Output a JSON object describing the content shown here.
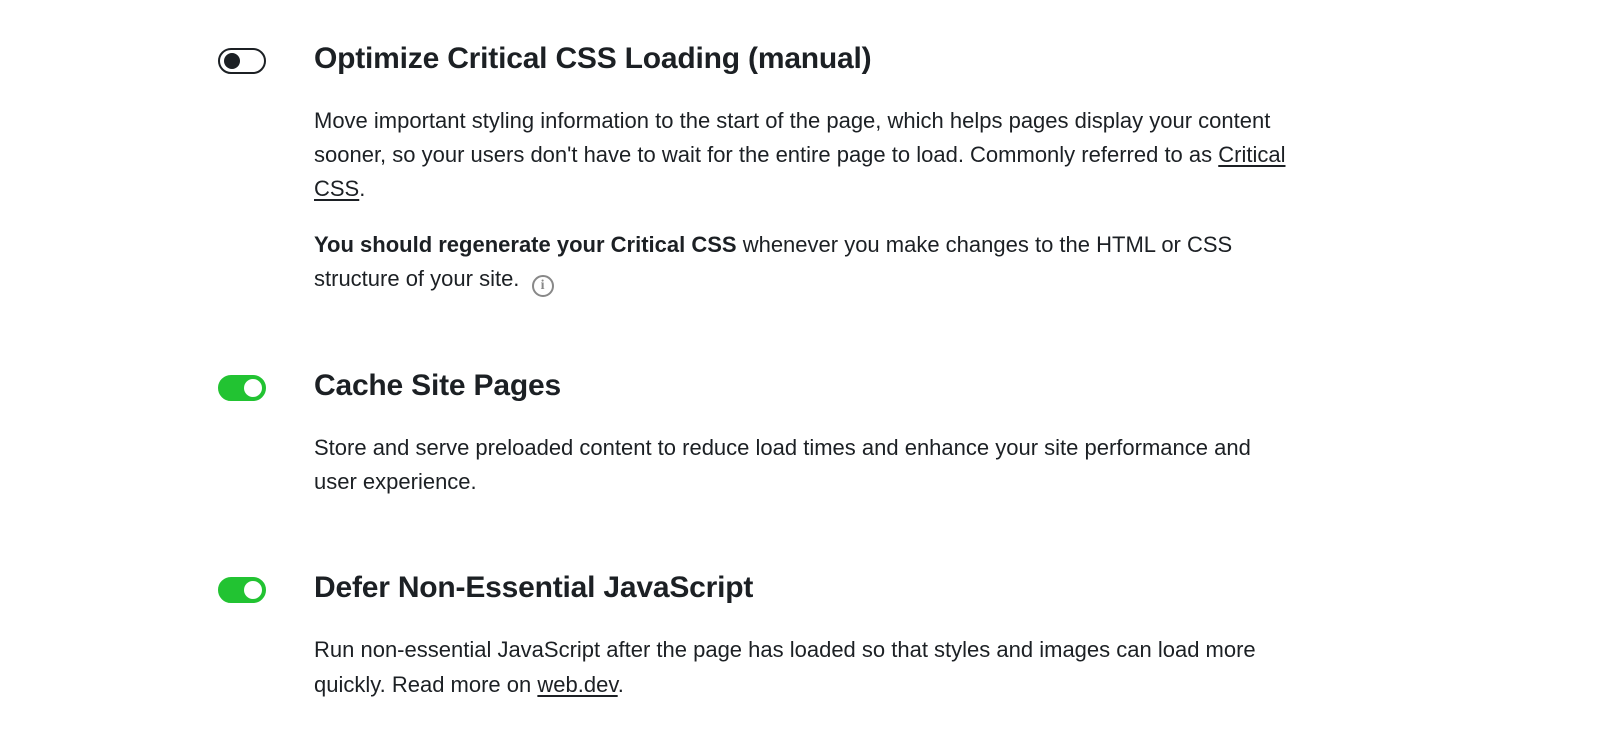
{
  "settings": [
    {
      "id": "optimize-critical-css",
      "enabled": false,
      "title": "Optimize Critical CSS Loading (manual)",
      "desc1_pre": "Move important styling information to the start of the page, which helps pages display your content sooner, so your users don't have to wait for the entire page to load. Commonly referred to as ",
      "desc1_link": "Critical CSS",
      "desc1_post": ".",
      "desc2_bold": "You should regenerate your Critical CSS",
      "desc2_rest": " whenever you make changes to the HTML or CSS structure of your site.  ",
      "has_info_icon": true
    },
    {
      "id": "cache-site-pages",
      "enabled": true,
      "title": "Cache Site Pages",
      "desc1_pre": "Store and serve preloaded content to reduce load times and enhance your site performance and user experience.",
      "desc1_link": "",
      "desc1_post": "",
      "desc2_bold": "",
      "desc2_rest": "",
      "has_info_icon": false
    },
    {
      "id": "defer-js",
      "enabled": true,
      "title": "Defer Non-Essential JavaScript",
      "desc1_pre": "Run non-essential JavaScript after the page has loaded so that styles and images can load more quickly. Read more on ",
      "desc1_link": "web.dev",
      "desc1_post": ".",
      "desc2_bold": "",
      "desc2_rest": "",
      "has_info_icon": false
    }
  ]
}
